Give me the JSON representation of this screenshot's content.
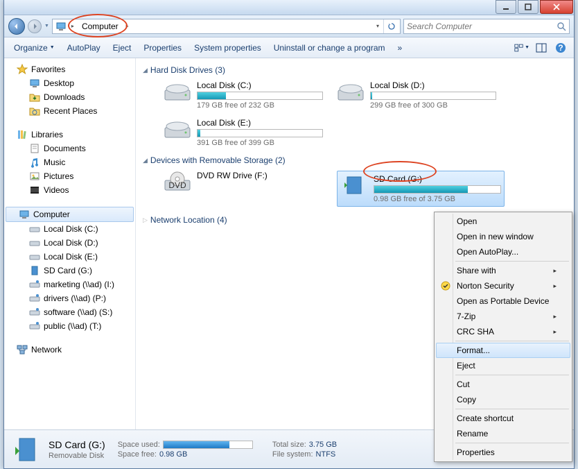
{
  "titlebar": {
    "min": "–",
    "max": "□",
    "close": "×"
  },
  "nav": {
    "breadcrumb": "Computer",
    "search_placeholder": "Search Computer"
  },
  "toolbar": {
    "organize": "Organize",
    "autoplay": "AutoPlay",
    "eject": "Eject",
    "properties": "Properties",
    "system_properties": "System properties",
    "uninstall": "Uninstall or change a program",
    "more": "»"
  },
  "sidebar": {
    "favorites": {
      "label": "Favorites",
      "items": [
        "Desktop",
        "Downloads",
        "Recent Places"
      ]
    },
    "libraries": {
      "label": "Libraries",
      "items": [
        "Documents",
        "Music",
        "Pictures",
        "Videos"
      ]
    },
    "computer": {
      "label": "Computer",
      "items": [
        "Local Disk (C:)",
        "Local Disk (D:)",
        "Local Disk (E:)",
        "SD Card (G:)",
        "marketing (\\\\ad) (I:)",
        "drivers (\\\\ad) (P:)",
        "software (\\\\ad) (S:)",
        "public (\\\\ad) (T:)"
      ]
    },
    "network": {
      "label": "Network"
    }
  },
  "sections": {
    "hdd": {
      "label": "Hard Disk Drives (3)"
    },
    "removable": {
      "label": "Devices with Removable Storage (2)"
    },
    "network": {
      "label": "Network Location (4)"
    }
  },
  "drives": {
    "c": {
      "name": "Local Disk (C:)",
      "free": "179 GB free of 232 GB",
      "pct": 23
    },
    "d": {
      "name": "Local Disk (D:)",
      "free": "299 GB free of 300 GB",
      "pct": 1
    },
    "e": {
      "name": "Local Disk (E:)",
      "free": "391 GB free of 399 GB",
      "pct": 2
    },
    "dvd": {
      "name": "DVD RW Drive (F:)"
    },
    "sd": {
      "name": "SD Card (G:)",
      "free": "0.98 GB free of 3.75 GB",
      "pct": 74
    }
  },
  "context_menu": {
    "items": [
      "Open",
      "Open in new window",
      "Open AutoPlay...",
      "-",
      "Share with",
      "Norton Security",
      "Open as Portable Device",
      "7-Zip",
      "CRC SHA",
      "-",
      "Format...",
      "Eject",
      "-",
      "Cut",
      "Copy",
      "-",
      "Create shortcut",
      "Rename",
      "-",
      "Properties"
    ],
    "submenu_flags": {
      "Share with": true,
      "Norton Security": true,
      "7-Zip": true,
      "CRC SHA": true
    },
    "selected": "Format..."
  },
  "status": {
    "title": "SD Card (G:)",
    "subtitle": "Removable Disk",
    "space_used_label": "Space used:",
    "space_free_label": "Space free:",
    "space_free_val": "0.98 GB",
    "total_size_label": "Total size:",
    "total_size_val": "3.75 GB",
    "fs_label": "File system:",
    "fs_val": "NTFS",
    "used_pct": 74
  }
}
